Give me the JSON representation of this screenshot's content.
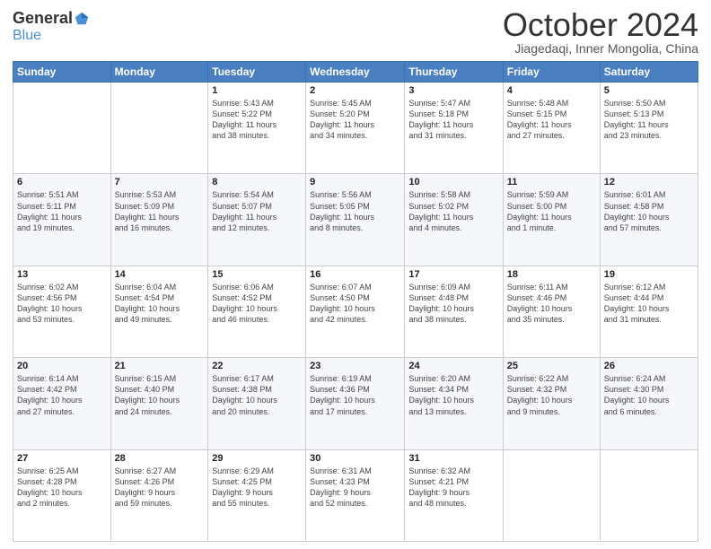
{
  "logo": {
    "general": "General",
    "blue": "Blue"
  },
  "title": {
    "month": "October 2024",
    "location": "Jiagedaqi, Inner Mongolia, China"
  },
  "weekdays": [
    "Sunday",
    "Monday",
    "Tuesday",
    "Wednesday",
    "Thursday",
    "Friday",
    "Saturday"
  ],
  "weeks": [
    [
      {
        "day": "",
        "info": ""
      },
      {
        "day": "",
        "info": ""
      },
      {
        "day": "1",
        "info": "Sunrise: 5:43 AM\nSunset: 5:22 PM\nDaylight: 11 hours\nand 38 minutes."
      },
      {
        "day": "2",
        "info": "Sunrise: 5:45 AM\nSunset: 5:20 PM\nDaylight: 11 hours\nand 34 minutes."
      },
      {
        "day": "3",
        "info": "Sunrise: 5:47 AM\nSunset: 5:18 PM\nDaylight: 11 hours\nand 31 minutes."
      },
      {
        "day": "4",
        "info": "Sunrise: 5:48 AM\nSunset: 5:15 PM\nDaylight: 11 hours\nand 27 minutes."
      },
      {
        "day": "5",
        "info": "Sunrise: 5:50 AM\nSunset: 5:13 PM\nDaylight: 11 hours\nand 23 minutes."
      }
    ],
    [
      {
        "day": "6",
        "info": "Sunrise: 5:51 AM\nSunset: 5:11 PM\nDaylight: 11 hours\nand 19 minutes."
      },
      {
        "day": "7",
        "info": "Sunrise: 5:53 AM\nSunset: 5:09 PM\nDaylight: 11 hours\nand 16 minutes."
      },
      {
        "day": "8",
        "info": "Sunrise: 5:54 AM\nSunset: 5:07 PM\nDaylight: 11 hours\nand 12 minutes."
      },
      {
        "day": "9",
        "info": "Sunrise: 5:56 AM\nSunset: 5:05 PM\nDaylight: 11 hours\nand 8 minutes."
      },
      {
        "day": "10",
        "info": "Sunrise: 5:58 AM\nSunset: 5:02 PM\nDaylight: 11 hours\nand 4 minutes."
      },
      {
        "day": "11",
        "info": "Sunrise: 5:59 AM\nSunset: 5:00 PM\nDaylight: 11 hours\nand 1 minute."
      },
      {
        "day": "12",
        "info": "Sunrise: 6:01 AM\nSunset: 4:58 PM\nDaylight: 10 hours\nand 57 minutes."
      }
    ],
    [
      {
        "day": "13",
        "info": "Sunrise: 6:02 AM\nSunset: 4:56 PM\nDaylight: 10 hours\nand 53 minutes."
      },
      {
        "day": "14",
        "info": "Sunrise: 6:04 AM\nSunset: 4:54 PM\nDaylight: 10 hours\nand 49 minutes."
      },
      {
        "day": "15",
        "info": "Sunrise: 6:06 AM\nSunset: 4:52 PM\nDaylight: 10 hours\nand 46 minutes."
      },
      {
        "day": "16",
        "info": "Sunrise: 6:07 AM\nSunset: 4:50 PM\nDaylight: 10 hours\nand 42 minutes."
      },
      {
        "day": "17",
        "info": "Sunrise: 6:09 AM\nSunset: 4:48 PM\nDaylight: 10 hours\nand 38 minutes."
      },
      {
        "day": "18",
        "info": "Sunrise: 6:11 AM\nSunset: 4:46 PM\nDaylight: 10 hours\nand 35 minutes."
      },
      {
        "day": "19",
        "info": "Sunrise: 6:12 AM\nSunset: 4:44 PM\nDaylight: 10 hours\nand 31 minutes."
      }
    ],
    [
      {
        "day": "20",
        "info": "Sunrise: 6:14 AM\nSunset: 4:42 PM\nDaylight: 10 hours\nand 27 minutes."
      },
      {
        "day": "21",
        "info": "Sunrise: 6:15 AM\nSunset: 4:40 PM\nDaylight: 10 hours\nand 24 minutes."
      },
      {
        "day": "22",
        "info": "Sunrise: 6:17 AM\nSunset: 4:38 PM\nDaylight: 10 hours\nand 20 minutes."
      },
      {
        "day": "23",
        "info": "Sunrise: 6:19 AM\nSunset: 4:36 PM\nDaylight: 10 hours\nand 17 minutes."
      },
      {
        "day": "24",
        "info": "Sunrise: 6:20 AM\nSunset: 4:34 PM\nDaylight: 10 hours\nand 13 minutes."
      },
      {
        "day": "25",
        "info": "Sunrise: 6:22 AM\nSunset: 4:32 PM\nDaylight: 10 hours\nand 9 minutes."
      },
      {
        "day": "26",
        "info": "Sunrise: 6:24 AM\nSunset: 4:30 PM\nDaylight: 10 hours\nand 6 minutes."
      }
    ],
    [
      {
        "day": "27",
        "info": "Sunrise: 6:25 AM\nSunset: 4:28 PM\nDaylight: 10 hours\nand 2 minutes."
      },
      {
        "day": "28",
        "info": "Sunrise: 6:27 AM\nSunset: 4:26 PM\nDaylight: 9 hours\nand 59 minutes."
      },
      {
        "day": "29",
        "info": "Sunrise: 6:29 AM\nSunset: 4:25 PM\nDaylight: 9 hours\nand 55 minutes."
      },
      {
        "day": "30",
        "info": "Sunrise: 6:31 AM\nSunset: 4:23 PM\nDaylight: 9 hours\nand 52 minutes."
      },
      {
        "day": "31",
        "info": "Sunrise: 6:32 AM\nSunset: 4:21 PM\nDaylight: 9 hours\nand 48 minutes."
      },
      {
        "day": "",
        "info": ""
      },
      {
        "day": "",
        "info": ""
      }
    ]
  ]
}
